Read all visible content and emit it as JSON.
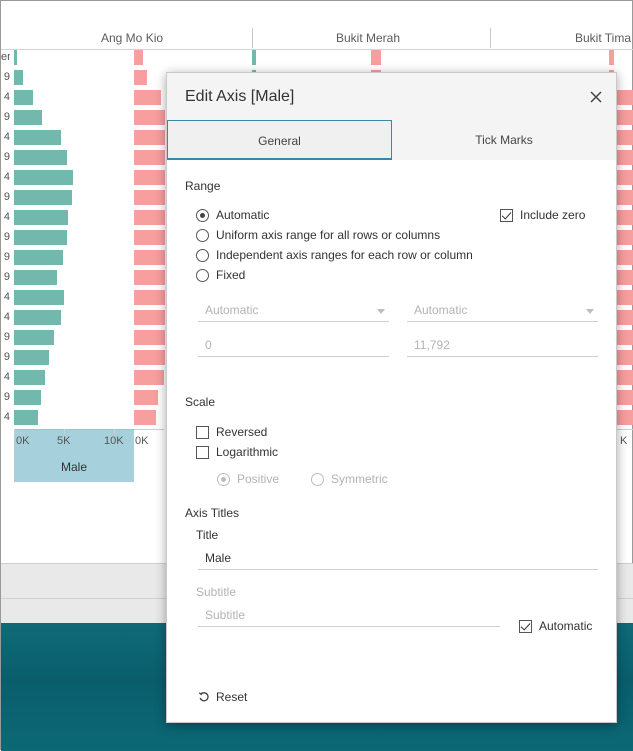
{
  "workspace": {
    "column_headers": [
      "Ang Mo Kio",
      "Bukit Merah",
      "Bukit Tima"
    ],
    "row_label_suffixes": [
      "er",
      "9",
      "4",
      "9",
      "4",
      "9",
      "4",
      "9",
      "4",
      "9",
      "9",
      "9",
      "4",
      "4",
      "9",
      "9",
      "4",
      "9",
      "4"
    ],
    "male_bar_levels_k": [
      0.3,
      0.9,
      1.9,
      2.8,
      4.7,
      5.3,
      5.9,
      5.8,
      5.4,
      5.3,
      4.9,
      4.3,
      5.0,
      4.7,
      4.0,
      3.5,
      3.1,
      2.7,
      2.4
    ],
    "female_bar_levels_relative": [
      0.26,
      0.38,
      0.82,
      0.95,
      0.95,
      0.95,
      0.95,
      0.95,
      0.95,
      0.95,
      0.95,
      0.95,
      0.95,
      0.95,
      0.95,
      0.95,
      0.9,
      0.72,
      0.67
    ],
    "male_axis_ticks": [
      "0K",
      "5K",
      "10K"
    ],
    "male_axis_max_k": 11.792,
    "female_axis_tick_left": "0K",
    "female_axis_tick_right": "K",
    "male_axis_title": "Male",
    "colors": {
      "male": "#73b8ad",
      "female": "#f79e9e",
      "selection": "#89c0d2"
    }
  },
  "dialog": {
    "title": "Edit Axis [Male]",
    "close_icon": "close-icon",
    "tabs": [
      {
        "label": "General",
        "active": true
      },
      {
        "label": "Tick Marks",
        "active": false
      }
    ],
    "range": {
      "heading": "Range",
      "options": [
        {
          "label": "Automatic",
          "selected": true
        },
        {
          "label": "Uniform axis range for all rows or columns",
          "selected": false
        },
        {
          "label": "Independent axis ranges for each row or column",
          "selected": false
        },
        {
          "label": "Fixed",
          "selected": false
        }
      ],
      "include_zero": {
        "label": "Include zero",
        "checked": true
      },
      "start_dropdown": "Automatic",
      "end_dropdown": "Automatic",
      "start_value": "0",
      "end_value": "11,792"
    },
    "scale": {
      "heading": "Scale",
      "reversed": {
        "label": "Reversed",
        "checked": false
      },
      "logarithmic": {
        "label": "Logarithmic",
        "checked": false
      },
      "positive": {
        "label": "Positive",
        "selected": true,
        "disabled": true
      },
      "symmetric": {
        "label": "Symmetric",
        "selected": false,
        "disabled": true
      }
    },
    "axis_titles": {
      "heading": "Axis Titles",
      "title_label": "Title",
      "title_value": "Male",
      "subtitle_label": "Subtitle",
      "subtitle_placeholder": "Subtitle",
      "automatic": {
        "label": "Automatic",
        "checked": true
      }
    },
    "reset_label": "Reset",
    "reset_icon": "reset-icon"
  }
}
